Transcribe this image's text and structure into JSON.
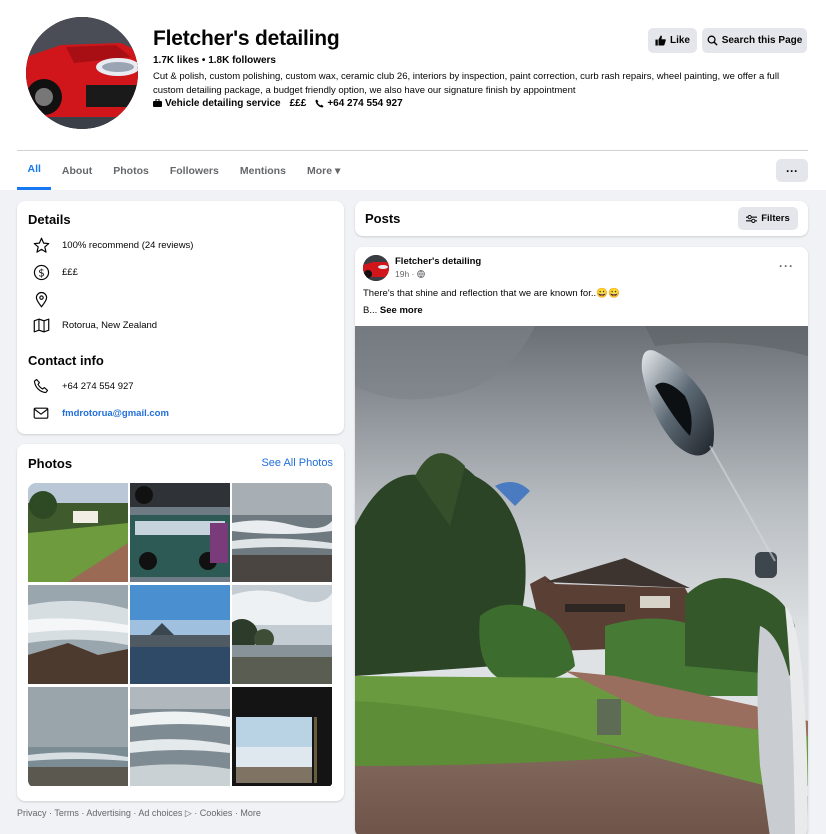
{
  "header": {
    "title": "Fletcher's detailing",
    "stats": "1.7K likes • 1.8K followers",
    "bio": "Cut & polish, custom polishing, custom wax, ceramic club 26, interiors by inspection, paint correction, curb rash repairs, wheel painting, we offer a full custom detailing package, a budget friendly option, we also have our signature finish by appointment",
    "category": "Vehicle detailing service",
    "price": "£££",
    "phone": "+64 274 554 927",
    "like_label": "Like",
    "search_label": "Search this Page"
  },
  "tabs": [
    {
      "label": "All",
      "active": true
    },
    {
      "label": "About"
    },
    {
      "label": "Photos"
    },
    {
      "label": "Followers"
    },
    {
      "label": "Mentions"
    },
    {
      "label": "More ▾"
    }
  ],
  "more_button": "···",
  "details": {
    "heading": "Details",
    "recommend": "100% recommend (24 reviews)",
    "price": "£££",
    "location": "Rotorua, New Zealand",
    "contact_heading": "Contact info",
    "phone": "+64 274 554 927",
    "email": "fmdrotorua@gmail.com"
  },
  "photos": {
    "heading": "Photos",
    "see_all": "See All Photos"
  },
  "footer": "Privacy · Terms · Advertising · Ad choices ▷ · Cookies · More",
  "posts": {
    "heading": "Posts",
    "filters_label": "Filters"
  },
  "post": {
    "author": "Fletcher's detailing",
    "time": "19h ·",
    "text": "There's that shine and reflection that we are known for..😀😀",
    "text2": "B... ",
    "see_more": "See more",
    "dots": "···"
  },
  "colors": {
    "accent": "#1877f2",
    "link": "#216fdb",
    "background": "#f0f2f5"
  }
}
